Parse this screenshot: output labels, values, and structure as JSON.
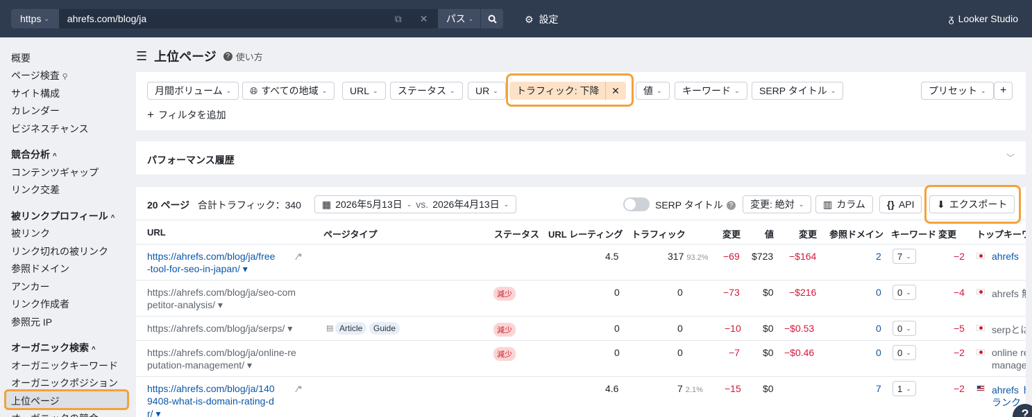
{
  "topbar": {
    "protocol": "https",
    "url": "ahrefs.com/blog/ja",
    "mode": "パス",
    "settings": "設定",
    "looker": "Looker Studio"
  },
  "sidebar": {
    "items": [
      {
        "label": "概要"
      },
      {
        "label": "ページ検査"
      },
      {
        "label": "サイト構成"
      },
      {
        "label": "カレンダー"
      },
      {
        "label": "ビジネスチャンス"
      },
      {
        "label": "競合分析"
      },
      {
        "label": "コンテンツギャップ"
      },
      {
        "label": "リンク交差"
      },
      {
        "label": "被リンクプロフィール"
      },
      {
        "label": "被リンク"
      },
      {
        "label": "リンク切れの被リンク"
      },
      {
        "label": "参照ドメイン"
      },
      {
        "label": "アンカー"
      },
      {
        "label": "リンク作成者"
      },
      {
        "label": "参照元 IP"
      },
      {
        "label": "オーガニック検索"
      },
      {
        "label": "オーガニックキーワード"
      },
      {
        "label": "オーガニックポジション"
      },
      {
        "label": "上位ページ"
      },
      {
        "label": "オーガニックの競合"
      }
    ]
  },
  "page": {
    "title": "上位ページ",
    "help": "使い方"
  },
  "filters": {
    "volume": "月間ボリューム",
    "region": "すべての地域",
    "url": "URL",
    "status": "ステータス",
    "ur": "UR",
    "traffic": "トラフィック: 下降",
    "value": "値",
    "keyword": "キーワード",
    "serp": "SERP タイトル",
    "preset": "プリセット",
    "add": "フィルタを追加"
  },
  "performance": {
    "title": "パフォーマンス履歴"
  },
  "table_bar": {
    "pages": "20 ページ",
    "total": "合計トラフィック：340",
    "date1": "2026年5月13日",
    "vs": "vs.",
    "date2": "2026年4月13日",
    "serp_toggle": "SERP タイトル",
    "change": "変更: 絶対",
    "columns": "カラム",
    "api": "API",
    "export": "エクスポート"
  },
  "table": {
    "headers": {
      "url": "URL",
      "pagetype": "ページタイプ",
      "status": "ステータス",
      "ur": "URL レーティング",
      "traffic": "トラフィック",
      "change1": "変更",
      "value": "値",
      "change2": "変更",
      "refdomains": "参照ドメイン",
      "keywords": "キーワード",
      "change3": "変更",
      "topkw": "トップキーワ"
    },
    "rows": [
      {
        "url1": "https://ahrefs.com/blog/ja/free",
        "url2": "-tool-for-seo-in-japan/ ▾",
        "url3": "",
        "tag1": "",
        "tag2": "",
        "status": "",
        "ur": "4.5",
        "traffic": "317",
        "pct": "93.2%",
        "ch1": "−69",
        "value": "$723",
        "ch2": "−$164",
        "rd": "2",
        "kw": "7",
        "ch3": "−2",
        "top1": "ahrefs",
        "top2": ""
      },
      {
        "url1": "https://ahrefs.com/blog/ja/seo-com",
        "url2": "petitor-analysis/ ▾",
        "url3": "",
        "tag1": "",
        "tag2": "",
        "status": "減少",
        "ur": "0",
        "traffic": "0",
        "pct": "",
        "ch1": "−73",
        "value": "$0",
        "ch2": "−$216",
        "rd": "0",
        "kw": "0",
        "ch3": "−4",
        "top1": "ahrefs 無",
        "top2": ""
      },
      {
        "url1": "https://ahrefs.com/blog/ja/serps/ ▾",
        "url2": "",
        "url3": "",
        "tag1": "Article",
        "tag2": "Guide",
        "status": "減少",
        "ur": "0",
        "traffic": "0",
        "pct": "",
        "ch1": "−10",
        "value": "$0",
        "ch2": "−$0.53",
        "rd": "0",
        "kw": "0",
        "ch3": "−5",
        "top1": "serpとは",
        "top2": ""
      },
      {
        "url1": "https://ahrefs.com/blog/ja/online-re",
        "url2": "putation-management/ ▾",
        "url3": "",
        "tag1": "",
        "tag2": "",
        "status": "減少",
        "ur": "0",
        "traffic": "0",
        "pct": "",
        "ch1": "−7",
        "value": "$0",
        "ch2": "−$0.46",
        "rd": "0",
        "kw": "0",
        "ch3": "−2",
        "top1": "online re",
        "top2": "manage"
      },
      {
        "url1": "https://ahrefs.com/blog/ja/140",
        "url2": "9408-what-is-domain-rating-d",
        "url3": "r/ ▾",
        "tag1": "",
        "tag2": "",
        "status": "",
        "ur": "4.6",
        "traffic": "7",
        "pct": "2.1%",
        "ch1": "−15",
        "value": "$0",
        "ch2": "",
        "rd": "7",
        "kw": "1",
        "ch3": "−2",
        "top1": "ahrefs ド",
        "top2": "ランク"
      }
    ]
  },
  "colors": {
    "topbar": "#2f3b4f",
    "highlight": "#f4a13a",
    "link": "#0b57a8",
    "negative": "#d1193a"
  },
  "help_bubble": "?"
}
